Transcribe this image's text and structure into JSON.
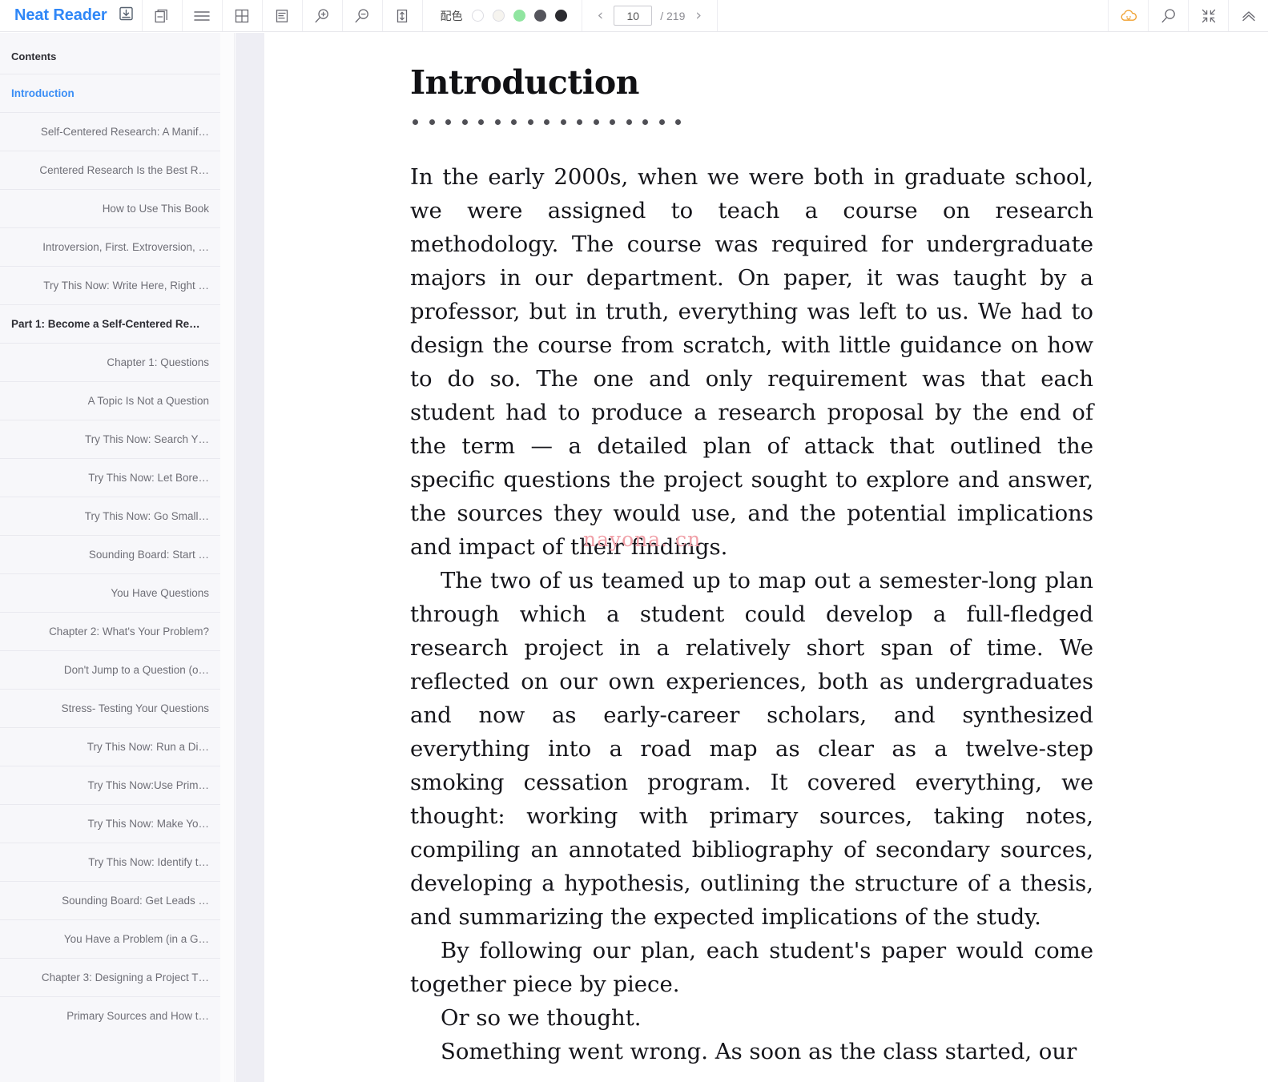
{
  "app": {
    "brand": "Neat Reader",
    "logo_icon": "book-download-icon"
  },
  "toolbar": {
    "buttons": [
      {
        "name": "library-icon",
        "title": "Library"
      },
      {
        "name": "menu-icon",
        "title": "Menu"
      },
      {
        "name": "grid-view-icon",
        "title": "Grid view"
      },
      {
        "name": "notes-icon",
        "title": "Notes"
      },
      {
        "name": "zoom-in-icon",
        "title": "Zoom in"
      },
      {
        "name": "zoom-out-icon",
        "title": "Zoom out"
      },
      {
        "name": "line-height-icon",
        "title": "Line spacing"
      }
    ],
    "scheme": {
      "label": "配色",
      "swatches": [
        {
          "name": "scheme-white",
          "color": "#ffffff",
          "border": "#dcdce2"
        },
        {
          "name": "scheme-sepia",
          "color": "#f6f4ef",
          "border": "#dcdce2"
        },
        {
          "name": "scheme-green",
          "color": "#90e5a0",
          "border": "#90e5a0"
        },
        {
          "name": "scheme-gray",
          "color": "#55555c",
          "border": "#55555c"
        },
        {
          "name": "scheme-black",
          "color": "#2b2b30",
          "border": "#2b2b30"
        }
      ]
    },
    "pager": {
      "prev": "‹",
      "next": "›",
      "current_page": "10",
      "total_label": "/ 219"
    },
    "right_buttons": [
      {
        "name": "cloud-sync-icon",
        "title": "Cloud sync",
        "color": "#f0a030"
      },
      {
        "name": "search-icon",
        "title": "Search"
      },
      {
        "name": "compress-icon",
        "title": "Exit full width"
      },
      {
        "name": "collapse-up-icon",
        "title": "Hide toolbar"
      }
    ]
  },
  "sidebar": {
    "title": "Contents",
    "items": [
      {
        "label": "Introduction",
        "level": 0,
        "state": "active"
      },
      {
        "label": "Self-Centered Research: A Manif…",
        "level": 1,
        "state": "normal"
      },
      {
        "label": "Centered Research Is the Best R…",
        "level": 1,
        "state": "normal"
      },
      {
        "label": "How to Use This Book",
        "level": 1,
        "state": "normal"
      },
      {
        "label": "Introversion, First. Extroversion, …",
        "level": 1,
        "state": "normal"
      },
      {
        "label": "Try This Now: Write Here, Right …",
        "level": 1,
        "state": "normal"
      },
      {
        "label": "Part 1: Become a Self-Centered Re…",
        "level": 0,
        "state": "bold"
      },
      {
        "label": "Chapter 1: Questions",
        "level": 1,
        "state": "normal"
      },
      {
        "label": "A Topic Is Not a Question",
        "level": 2,
        "state": "normal"
      },
      {
        "label": "Try This Now: Search Y…",
        "level": 3,
        "state": "normal"
      },
      {
        "label": "Try This Now: Let Bore…",
        "level": 3,
        "state": "normal"
      },
      {
        "label": "Try This Now: Go Small…",
        "level": 3,
        "state": "normal"
      },
      {
        "label": "Sounding Board: Start …",
        "level": 3,
        "state": "normal"
      },
      {
        "label": "You Have Questions",
        "level": 2,
        "state": "normal"
      },
      {
        "label": "Chapter 2: What's Your Problem?",
        "level": 1,
        "state": "normal"
      },
      {
        "label": "Don't Jump to a Question (o…",
        "level": 2,
        "state": "normal"
      },
      {
        "label": "Stress- Testing Your Questions",
        "level": 2,
        "state": "normal"
      },
      {
        "label": "Try This Now: Run a Di…",
        "level": 3,
        "state": "normal"
      },
      {
        "label": "Try This Now:Use Prim…",
        "level": 3,
        "state": "normal"
      },
      {
        "label": "Try This Now: Make Yo…",
        "level": 3,
        "state": "normal"
      },
      {
        "label": "Try This Now: Identify t…",
        "level": 3,
        "state": "normal"
      },
      {
        "label": "Sounding Board: Get Leads …",
        "level": 2,
        "state": "normal"
      },
      {
        "label": "You Have a Problem (in a G…",
        "level": 2,
        "state": "normal"
      },
      {
        "label": "Chapter 3: Designing a Project T…",
        "level": 1,
        "state": "normal"
      },
      {
        "label": "Primary Sources and How t…",
        "level": 2,
        "state": "normal"
      }
    ]
  },
  "content": {
    "chapter_title": "Introduction",
    "dot_count": 17,
    "watermark": "nayona. cn",
    "paragraphs": [
      {
        "indent": false,
        "text": "In the early 2000s, when we were both in graduate school, we were assigned to teach a course on research methodology. The course was required for undergraduate majors in our department. On paper, it was taught by a professor, but in truth, everything was left to us. We had to design the course from scratch, with little guidance on how to do so. The one and only requirement was that each student had to produce a research proposal by the end of the term — a detailed plan of attack that outlined the specific questions the project sought to explore and answer, the sources they would use, and the potential implications and impact of their findings."
      },
      {
        "indent": true,
        "text": "The two of us teamed up to map out a semester-long plan through which a student could develop a full-fledged research project in a relatively short span of time. We reflected on our own experiences, both as undergraduates and now as early-career scholars, and synthesized everything into a road map as clear as a twelve-step smoking cessation program. It covered everything, we thought: working with primary sources, taking notes, compiling an annotated bibliography of secondary sources, developing a hypothesis, outlining the structure of a thesis, and summarizing the expected implications of the study."
      },
      {
        "indent": true,
        "text": "By following our plan, each student's paper would come together piece by piece."
      },
      {
        "indent": true,
        "text": "Or so we thought."
      },
      {
        "indent": true,
        "text": "Something went wrong. As soon as the class started, our"
      }
    ]
  }
}
